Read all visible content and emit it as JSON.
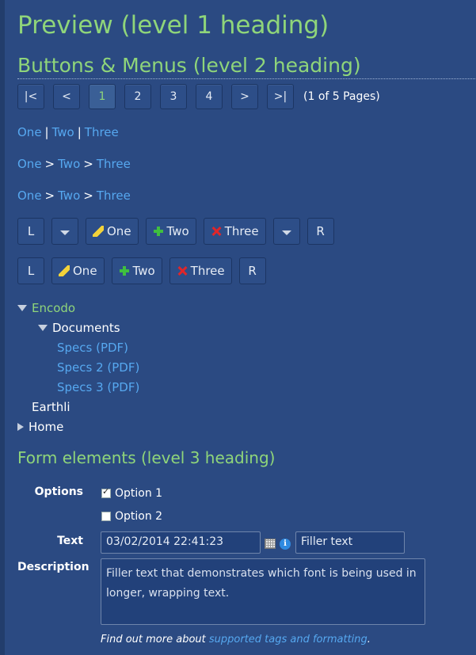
{
  "headings": {
    "h1": "Preview (level 1 heading)",
    "h2": "Buttons & Menus (level 2 heading)",
    "h3": "Form elements (level 3 heading)"
  },
  "pager": {
    "first": "|<",
    "prev": "<",
    "pages": [
      "1",
      "2",
      "3",
      "4"
    ],
    "selected_page": "1",
    "next": ">",
    "last": ">|",
    "info": "(1 of 5 Pages)"
  },
  "nav_lists": {
    "pipe": [
      "One",
      "Two",
      "Three"
    ],
    "pipe_sep": "|",
    "breadcrumb_a": [
      "One",
      "Two",
      "Three"
    ],
    "breadcrumb_b": [
      "One",
      "Two",
      "Three"
    ],
    "crumb_sep": ">"
  },
  "button_row_1": {
    "left": "L",
    "one": "One",
    "two": "Two",
    "three": "Three",
    "right": "R"
  },
  "button_row_2": {
    "left": "L",
    "one": "One",
    "two": "Two",
    "three": "Three",
    "right": "R"
  },
  "tree": {
    "root": "Encodo",
    "documents": "Documents",
    "specs": [
      "Specs (PDF)",
      "Specs 2 (PDF)",
      "Specs 3 (PDF)"
    ],
    "earthli": "Earthli",
    "home": "Home"
  },
  "form": {
    "options_label": "Options",
    "option1": "Option 1",
    "option2": "Option 2",
    "text_label": "Text",
    "date_value": "03/02/2014 22:41:23",
    "filler_value": "Filler text",
    "description_label": "Description",
    "description_value": "Filler text that demonstrates which font is being used in longer, wrapping text.",
    "footer_prefix": "Find out more about ",
    "footer_link": "supported tags and formatting",
    "footer_suffix": "."
  },
  "colors": {
    "background": "#2b4a82",
    "heading_green": "#8fd57a",
    "link_blue": "#56a8f0"
  },
  "icons": [
    "pencil-icon",
    "plus-icon",
    "delete-icon",
    "calendar-icon",
    "info-icon",
    "chevron-down-icon",
    "tree-expanded-icon",
    "tree-collapsed-icon"
  ]
}
